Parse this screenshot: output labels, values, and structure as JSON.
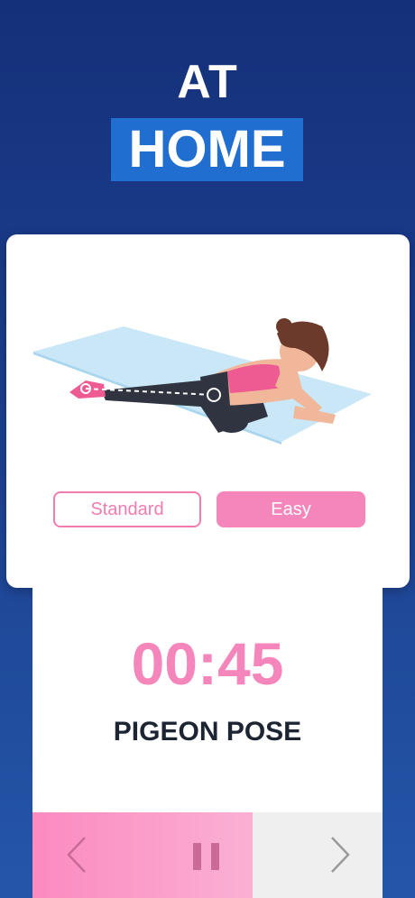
{
  "header": {
    "line1": "AT",
    "line2": "HOME"
  },
  "options": {
    "standard_label": "Standard",
    "easy_label": "Easy",
    "selected": "Easy"
  },
  "workout": {
    "timer": "00:45",
    "exercise_name": "PIGEON POSE",
    "progress": 0.63
  },
  "controls": {
    "prev_icon": "chevron-left-icon",
    "pause_icon": "pause-icon",
    "next_icon": "chevron-right-icon"
  },
  "colors": {
    "accent_pink": "#f586bb",
    "home_highlight": "#1f6ed0",
    "background": "#1c3f8f",
    "text_dark": "#1d2533"
  }
}
